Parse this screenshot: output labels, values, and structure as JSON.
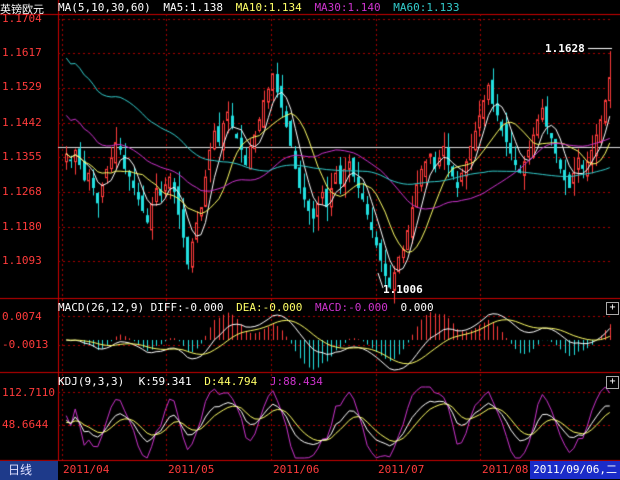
{
  "header": {
    "instrument": "英镑欧元",
    "ma_params": "MA(5,10,30,60)",
    "ma5": "MA5:1.138",
    "ma10": "MA10:1.134",
    "ma30": "MA30:1.140",
    "ma60": "MA60:1.133"
  },
  "price_axis": [
    "1.1704",
    "1.1617",
    "1.1529",
    "1.1442",
    "1.1355",
    "1.1268",
    "1.1180",
    "1.1093"
  ],
  "high_label": "1.1628",
  "low_label": "1.1006",
  "macd_header": {
    "params": "MACD(26,12,9)",
    "diff": "DIFF:-0.000",
    "dea": "DEA:-0.000",
    "macd": "MACD:-0.000",
    "extra": "0.000"
  },
  "macd_axis": [
    "0.0074",
    "-0.0013"
  ],
  "kdj_header": {
    "params": "KDJ(9,3,3)",
    "k": "K:59.341",
    "d": "D:44.794",
    "j": "J:88.434"
  },
  "kdj_axis": [
    "112.7110",
    "48.6644"
  ],
  "period_tab": "日线",
  "x_axis": [
    "2011/04",
    "2011/05",
    "2011/06",
    "2011/07",
    "2011/08"
  ],
  "cursor_date": "2011/09/06,二",
  "plus_label": "+",
  "colors": {
    "up": "#ff3b3b",
    "down": "#22e0e0",
    "ma5": "#ffffff",
    "ma10": "#ffff66",
    "ma30": "#cc33cc",
    "ma60": "#33cccc",
    "grid": "#aa0000",
    "axis_text": "#ff3b3b"
  },
  "chart_data": {
    "type": "candlestick",
    "price_range": [
      1.0985,
      1.1725
    ],
    "high": 1.1628,
    "low": 1.1006,
    "close_path": [
      1.136,
      1.134,
      1.137,
      1.133,
      1.129,
      1.131,
      1.127,
      1.123,
      1.128,
      1.132,
      1.135,
      1.139,
      1.137,
      1.132,
      1.13,
      1.127,
      1.124,
      1.121,
      1.118,
      1.123,
      1.127,
      1.125,
      1.128,
      1.13,
      1.126,
      1.12,
      1.114,
      1.107,
      1.113,
      1.118,
      1.122,
      1.13,
      1.137,
      1.142,
      1.139,
      1.144,
      1.147,
      1.143,
      1.14,
      1.137,
      1.133,
      1.138,
      1.141,
      1.145,
      1.15,
      1.153,
      1.157,
      1.152,
      1.148,
      1.143,
      1.138,
      1.132,
      1.127,
      1.124,
      1.121,
      1.119,
      1.123,
      1.126,
      1.122,
      1.127,
      1.131,
      1.128,
      1.132,
      1.134,
      1.13,
      1.127,
      1.124,
      1.12,
      1.116,
      1.112,
      1.108,
      1.104,
      1.101,
      1.105,
      1.109,
      1.111,
      1.116,
      1.122,
      1.128,
      1.132,
      1.134,
      1.136,
      1.132,
      1.135,
      1.138,
      1.133,
      1.13,
      1.127,
      1.131,
      1.134,
      1.138,
      1.142,
      1.146,
      1.15,
      1.154,
      1.149,
      1.146,
      1.142,
      1.139,
      1.136,
      1.133,
      1.131,
      1.134,
      1.137,
      1.141,
      1.145,
      1.148,
      1.143,
      1.14,
      1.136,
      1.132,
      1.129,
      1.127,
      1.131,
      1.135,
      1.132,
      1.134,
      1.137,
      1.141,
      1.145,
      1.15,
      1.156
    ]
  }
}
